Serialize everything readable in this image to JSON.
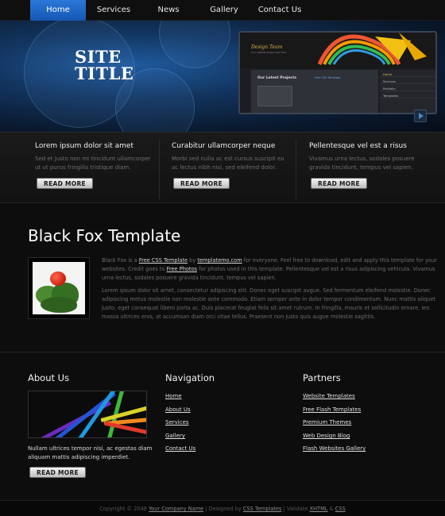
{
  "nav": {
    "items": [
      "Home",
      "Services",
      "News",
      "Gallery",
      "Contact Us"
    ],
    "active": "Home",
    "accent": "#1e66c4"
  },
  "header": {
    "site_title_line1": "SITE",
    "site_title_line2": "TITLE",
    "preview": {
      "brand": "Design Team",
      "tagline": "Your website slogan text here",
      "latest_projects": "Our Latest Projects",
      "link": "Free CSS Template",
      "menu": [
        "Home",
        "Services",
        "Portfolio",
        "Templates"
      ]
    },
    "play_icon": "play-icon"
  },
  "features": [
    {
      "title": "Lorem ipsum dolor sit amet",
      "text": "Sed et justo non mi tincidunt ullamcorper ut ut purus fringilla tristique diam.",
      "button": "READ MORE"
    },
    {
      "title": "Curabitur ullamcorper neque",
      "text": "Morbi sed nulla ac est cursus suscipit eu ac lectus nibh nisi, sed eleifend dolor.",
      "button": "READ MORE"
    },
    {
      "title": "Pellentesque vel est a risus",
      "text": "Vivamus urna lectus, sodales posuere gravida tincidunt, tempus vel sapien.",
      "button": "READ MORE"
    }
  ],
  "main": {
    "title": "Black Fox Template",
    "p1": {
      "t1": "Black Fox is a ",
      "l1": "Free CSS Template",
      "t2": " by ",
      "l2": "templatemo.com",
      "t3": " for everyone. Feel free to download, edit and apply this template for your websites. Credit goes to ",
      "l3": "Free Photos",
      "t4": " for photos used in this template. Pellentesque vel est a risus adipiscing vehicula. Vivamus urna lectus, sodales posuere gravida tincidunt, tempus vel sapien."
    },
    "p2": "Lorem ipsum dolor sit amet, consectetur adipiscing elit. Donec eget suscipit augue. Sed fermentum eleifend molestie. Donec adipiscing metus molestie non molestie ante commodo. Etiam semper ante in dolor tempor condimentum. Nunc mattis aliquet justo, eget consequat libero porta ac. Duis placerat feugiat felis sit amet rutrum. In fringilla, mauris et sollicitudin ornare, leo massa ultrices eros, at accumsan diam orci vitae tellus. Praesent non justo quis augue molestie sagittis."
  },
  "footer": {
    "about": {
      "title": "About Us",
      "text": "Nullam ultrices tempor nisi, ac egestas diam aliquam mattis adipiscing imperdiet.",
      "button": "READ MORE"
    },
    "navigation": {
      "title": "Navigation",
      "links": [
        "Home",
        "About Us",
        "Services",
        "Gallery",
        "Contact Us"
      ]
    },
    "partners": {
      "title": "Partners",
      "links": [
        "Website Templates",
        "Free Flash Templates",
        "Premium Themes",
        "Web Design Blog",
        "Flash Websites Gallery"
      ]
    }
  },
  "bottom": {
    "prefix": "Copyright © 2048 ",
    "company": "Your Company Name",
    "designed": " | Designed by ",
    "designer": "CSS Templates",
    "validate": " | Validate ",
    "xhtml": "XHTML",
    "amp": " & ",
    "css": "CSS"
  }
}
